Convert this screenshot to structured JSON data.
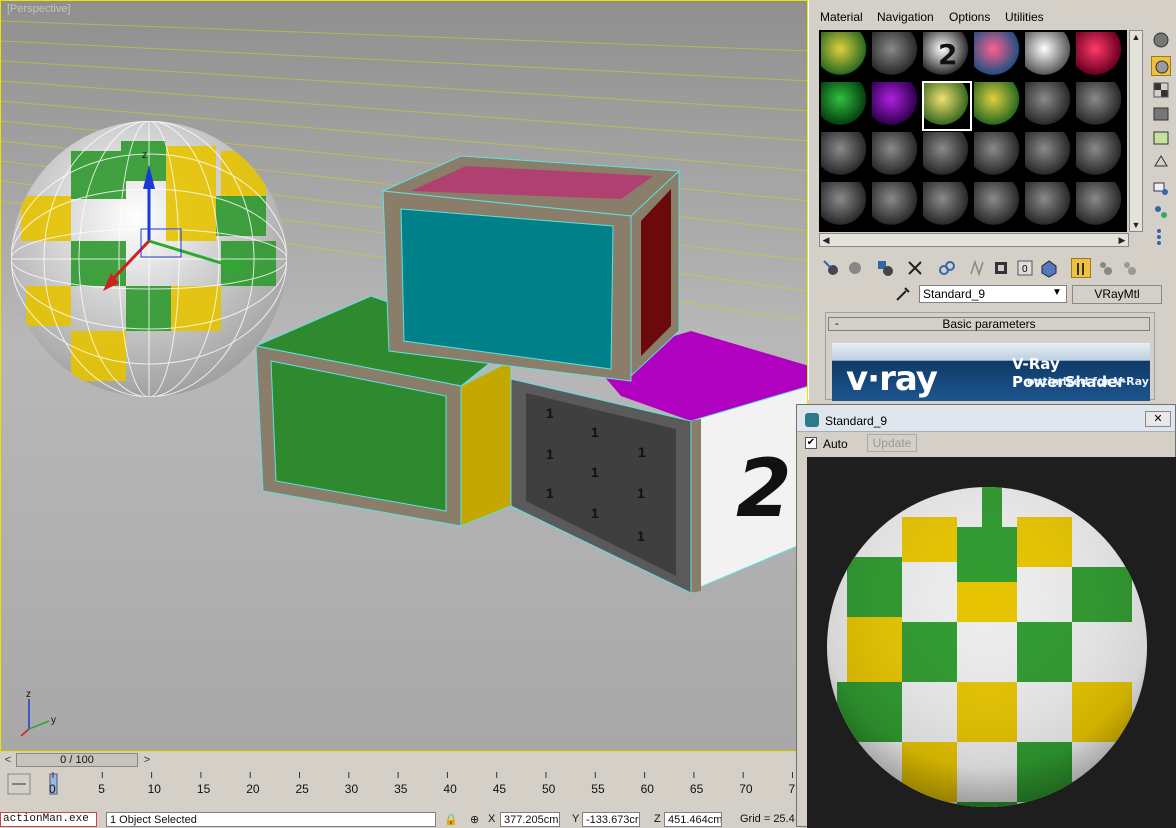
{
  "viewport": {
    "label": "[Perspective]",
    "gizmo_z": "z",
    "corner_axes": {
      "z": "z",
      "y": "y"
    },
    "box2_number": "2",
    "box1_digits": [
      "1",
      "1",
      "1",
      "1",
      "1",
      "1",
      "1",
      "1",
      "1",
      "1"
    ]
  },
  "timeline": {
    "prev": "<",
    "next": ">",
    "slider_text": "0 / 100",
    "ticks": [
      "0",
      "5",
      "10",
      "15",
      "20",
      "25",
      "30",
      "35",
      "40",
      "45",
      "50",
      "55",
      "60",
      "65",
      "70",
      "7"
    ]
  },
  "status": {
    "process": "actionMan.exe",
    "selection": "1 Object Selected",
    "x_label": "X",
    "x_value": "377.205cm",
    "y_label": "Y",
    "y_value": "-133.673cr",
    "z_label": "Z",
    "z_value": "451.464cm",
    "grid": "Grid = 25.4"
  },
  "material_editor": {
    "menu": [
      "Material",
      "Navigation",
      "Options",
      "Utilities"
    ],
    "slot_number_label": "2",
    "material_name": "Standard_9",
    "material_type": "VRayMtl",
    "rollout_title": "Basic parameters",
    "rollout_toggle": "-",
    "banner": {
      "logo": "v·ray",
      "title": "V-Ray PowerShader",
      "subtitle": "optimized for V-Ray"
    },
    "slot_colors": [
      "checker",
      "gray",
      "ball2",
      "mixed",
      "white",
      "crimson",
      "green",
      "purple",
      "checker-sel",
      "checker",
      "gray",
      "gray",
      "gray",
      "gray",
      "gray",
      "gray",
      "gray",
      "gray",
      "gray",
      "gray",
      "gray",
      "gray",
      "gray",
      "gray"
    ]
  },
  "preview_window": {
    "title": "Standard_9",
    "close": "✕",
    "auto_label": "Auto",
    "auto_checked": "✔",
    "update_label": "Update"
  },
  "colors": {
    "checker_green": "#2f9a2f",
    "checker_yellow": "#e6c400",
    "selection_wire": "#5fe0e0"
  }
}
